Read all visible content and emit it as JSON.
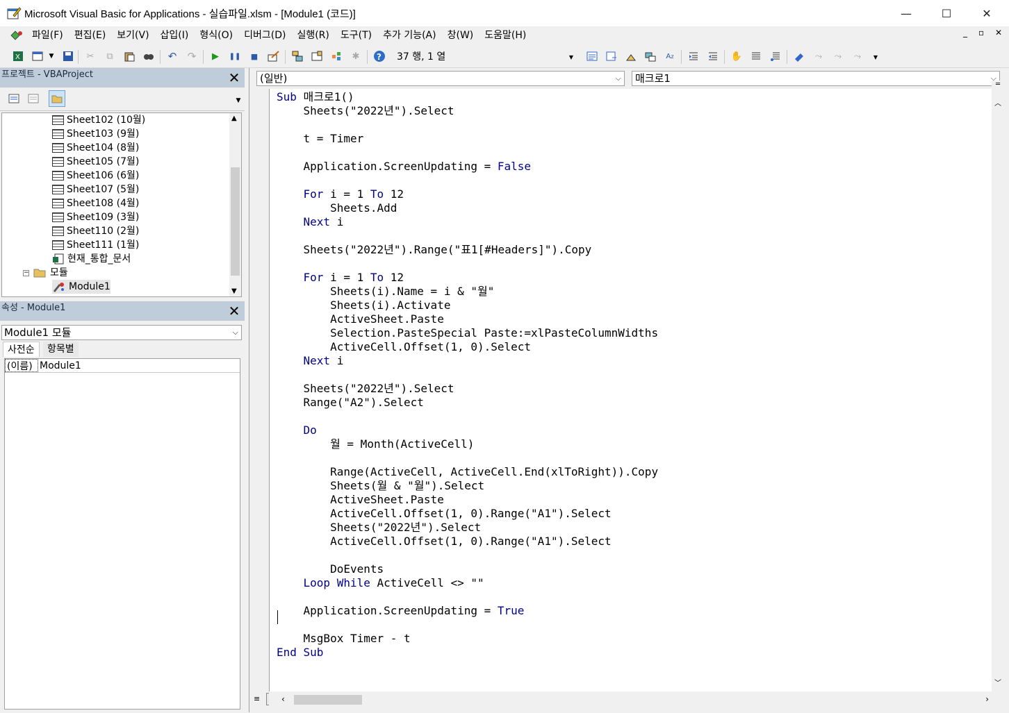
{
  "window": {
    "title": "Microsoft Visual Basic for Applications - 실습파일.xlsm - [Module1 (코드)]",
    "minimize": "—",
    "maximize": "☐",
    "close": "✕"
  },
  "menu": {
    "items": [
      "파일(F)",
      "편집(E)",
      "보기(V)",
      "삽입(I)",
      "형식(O)",
      "디버그(D)",
      "실행(R)",
      "도구(T)",
      "추가 기능(A)",
      "창(W)",
      "도움말(H)"
    ],
    "mdi_min": "_",
    "mdi_restore": "▫",
    "mdi_close": "✕"
  },
  "toolbar": {
    "position": "37 행, 1 열"
  },
  "project": {
    "title": "프로젝트 - VBAProject",
    "tree": [
      {
        "label": "Sheet102 (10월)"
      },
      {
        "label": "Sheet103 (9월)"
      },
      {
        "label": "Sheet104 (8월)"
      },
      {
        "label": "Sheet105 (7월)"
      },
      {
        "label": "Sheet106 (6월)"
      },
      {
        "label": "Sheet107 (5월)"
      },
      {
        "label": "Sheet108 (4월)"
      },
      {
        "label": "Sheet109 (3월)"
      },
      {
        "label": "Sheet110 (2월)"
      },
      {
        "label": "Sheet111 (1월)"
      },
      {
        "label": "현재_통합_문서"
      }
    ],
    "modules_folder": "모듈",
    "module_item": "Module1"
  },
  "properties": {
    "title": "속성 - Module1",
    "object": "Module1 모듈",
    "tabs": [
      "사전순",
      "항목별"
    ],
    "row_name": "(이름)",
    "row_value": "Module1"
  },
  "code": {
    "object_combo": "(일반)",
    "proc_combo": "매크로1",
    "lines": [
      "Sub 매크로1()",
      "    Sheets(\"2022년\").Select",
      "",
      "    t = Timer",
      "",
      "    Application.ScreenUpdating = False",
      "",
      "    For i = 1 To 12",
      "        Sheets.Add",
      "    Next i",
      "",
      "    Sheets(\"2022년\").Range(\"표1[#Headers]\").Copy",
      "",
      "    For i = 1 To 12",
      "        Sheets(i).Name = i & \"월\"",
      "        Sheets(i).Activate",
      "        ActiveSheet.Paste",
      "        Selection.PasteSpecial Paste:=xlPasteColumnWidths",
      "        ActiveCell.Offset(1, 0).Select",
      "    Next i",
      "",
      "    Sheets(\"2022년\").Select",
      "    Range(\"A2\").Select",
      "",
      "    Do",
      "        월 = Month(ActiveCell)",
      "",
      "        Range(ActiveCell, ActiveCell.End(xlToRight)).Copy",
      "        Sheets(월 & \"월\").Select",
      "        ActiveSheet.Paste",
      "        ActiveCell.Offset(1, 0).Range(\"A1\").Select",
      "        Sheets(\"2022년\").Select",
      "        ActiveCell.Offset(1, 0).Range(\"A1\").Select",
      "",
      "        DoEvents",
      "    Loop While ActiveCell <> \"\"",
      "",
      "    Application.ScreenUpdating = True",
      "",
      "    MsgBox Timer - t",
      "End Sub"
    ]
  }
}
